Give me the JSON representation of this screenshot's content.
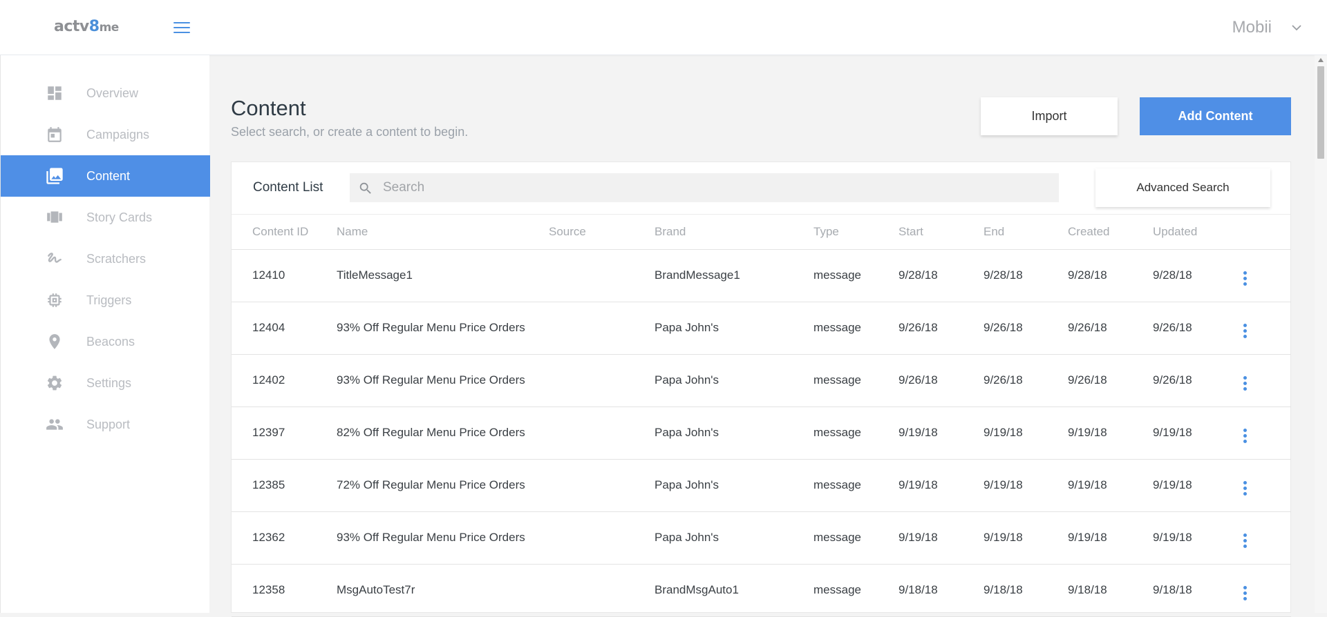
{
  "header": {
    "logo": {
      "part1": "actv",
      "part2": "8",
      "part3": "me"
    },
    "user_name": "Mobii",
    "accent_color": "#4f8fe6"
  },
  "sidebar": {
    "items": [
      {
        "label": "Overview",
        "icon": "dashboard-icon",
        "active": false
      },
      {
        "label": "Campaigns",
        "icon": "calendar-icon",
        "active": false
      },
      {
        "label": "Content",
        "icon": "photo-library-icon",
        "active": true
      },
      {
        "label": "Story Cards",
        "icon": "carousel-icon",
        "active": false
      },
      {
        "label": "Scratchers",
        "icon": "gesture-icon",
        "active": false
      },
      {
        "label": "Triggers",
        "icon": "chip-icon",
        "active": false
      },
      {
        "label": "Beacons",
        "icon": "location-pin-icon",
        "active": false
      },
      {
        "label": "Settings",
        "icon": "gear-icon",
        "active": false
      },
      {
        "label": "Support",
        "icon": "people-icon",
        "active": false
      }
    ]
  },
  "main": {
    "title": "Content",
    "subtitle": "Select search, or create a content to begin.",
    "import_label": "Import",
    "add_label": "Add Content"
  },
  "panel": {
    "title": "Content List",
    "search_placeholder": "Search",
    "advanced_label": "Advanced Search",
    "columns": [
      "Content ID",
      "Name",
      "Source",
      "Brand",
      "Type",
      "Start",
      "End",
      "Created",
      "Updated"
    ],
    "rows": [
      {
        "id": "12410",
        "name": "TitleMessage1",
        "source": "",
        "brand": "BrandMessage1",
        "type": "message",
        "start": "9/28/18",
        "end": "9/28/18",
        "created": "9/28/18",
        "updated": "9/28/18"
      },
      {
        "id": "12404",
        "name": "93% Off Regular Menu Price Orders",
        "source": "",
        "brand": "Papa John's",
        "type": "message",
        "start": "9/26/18",
        "end": "9/26/18",
        "created": "9/26/18",
        "updated": "9/26/18"
      },
      {
        "id": "12402",
        "name": "93% Off Regular Menu Price Orders",
        "source": "",
        "brand": "Papa John's",
        "type": "message",
        "start": "9/26/18",
        "end": "9/26/18",
        "created": "9/26/18",
        "updated": "9/26/18"
      },
      {
        "id": "12397",
        "name": "82% Off Regular Menu Price Orders",
        "source": "",
        "brand": "Papa John's",
        "type": "message",
        "start": "9/19/18",
        "end": "9/19/18",
        "created": "9/19/18",
        "updated": "9/19/18"
      },
      {
        "id": "12385",
        "name": "72% Off Regular Menu Price Orders",
        "source": "",
        "brand": "Papa John's",
        "type": "message",
        "start": "9/19/18",
        "end": "9/19/18",
        "created": "9/19/18",
        "updated": "9/19/18"
      },
      {
        "id": "12362",
        "name": "93% Off Regular Menu Price Orders",
        "source": "",
        "brand": "Papa John's",
        "type": "message",
        "start": "9/19/18",
        "end": "9/19/18",
        "created": "9/19/18",
        "updated": "9/19/18"
      },
      {
        "id": "12358",
        "name": "MsgAutoTest7r",
        "source": "",
        "brand": "BrandMsgAuto1",
        "type": "message",
        "start": "9/18/18",
        "end": "9/18/18",
        "created": "9/18/18",
        "updated": "9/18/18"
      }
    ]
  }
}
